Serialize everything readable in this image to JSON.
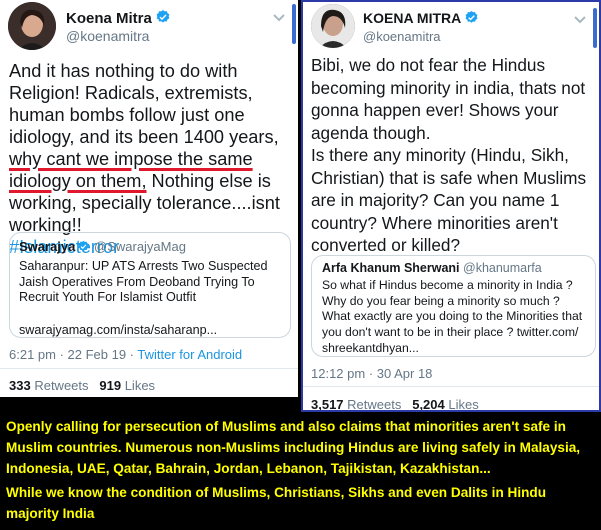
{
  "tweet_left": {
    "name": "Koena Mitra",
    "handle": "@koenamitra",
    "text_part1": "And it has nothing to do with Religion! Radicals, extremists, human bombs follow just one idiology, and its been 1400 years, ",
    "text_underlined": "why cant we impose the same idiology on them,",
    "text_part2": " Nothing else is working, specially tolerance....isnt working!!",
    "hashtag": "#Islamicterror",
    "quote": {
      "name": "Swarajya",
      "handle": "@SwarajyaMag",
      "text": "Saharanpur: UP ATS Arrests Two Suspected Jaish Operatives From Deoband Trying To Recruit Youth For Islamist Outfit",
      "link": "swarajyamag.com/insta/saharanp..."
    },
    "timestamp": "6:21 pm · 22 Feb 19 · ",
    "source": "Twitter for Android",
    "retweets_count": "333",
    "retweets_label": "Retweets",
    "likes_count": "919",
    "likes_label": "Likes"
  },
  "tweet_right": {
    "name": "KOENA MITRA",
    "handle": "@koenamitra",
    "text": "Bibi, we do not fear the Hindus becoming minority in india, thats not gonna happen ever! Shows your agenda though.\nIs there any minority (Hindu, Sikh, Christian) that is safe when Muslims are in majority? Can you name 1 country? Where minorities aren't converted or killed?",
    "quote": {
      "name": "Arfa Khanum Sherwani",
      "handle": "@khanumarfa",
      "text": "So what if Hindus become a minority in India ? Why do you fear being a minority so much ? What exactly are you doing to the Minorities that you don't want to be in their place ? twitter.com/ shreekantdhyan..."
    },
    "timestamp": "12:12 pm · 30 Apr 18",
    "retweets_count": "3,517",
    "retweets_label": "Retweets",
    "likes_count": "5,204",
    "likes_label": "Likes"
  },
  "caption": {
    "paragraph1": "Openly calling for persecution of Muslims and also claims that minorities aren't safe in Muslim countries. Numerous non-Muslims including Hindus are living safely in Malaysia, Indonesia, UAE, Qatar, Bahrain, Jordan, Lebanon, Tajikistan, Kazakhistan...",
    "paragraph2": "While we know the condition of Muslims, Christians, Sikhs and even Dalits in Hindu majority India"
  },
  "colors": {
    "verified_blue": "#1da1f2",
    "link_blue": "#1b95e0",
    "underline_red": "#e0182d",
    "caption_yellow": "#ffff00",
    "right_border": "#2b3aa8"
  },
  "icons": [
    "verified-badge-icon",
    "chevron-down-icon",
    "avatar"
  ]
}
